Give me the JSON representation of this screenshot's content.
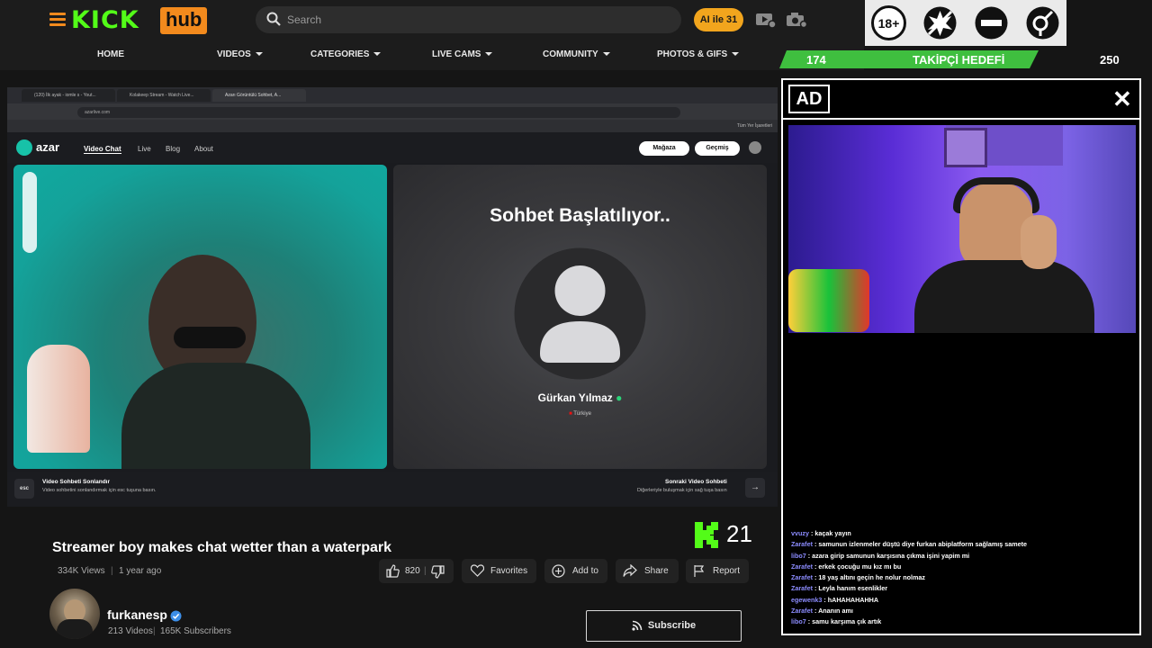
{
  "header": {
    "logo_kick": "KICK",
    "logo_hub": "hub",
    "search_placeholder": "Search",
    "promo_label": "AI ile 31",
    "nav": [
      "HOME",
      "VIDEOS",
      "CATEGORIES",
      "LIVE CAMS",
      "COMMUNITY",
      "PHOTOS & GIFS"
    ]
  },
  "overlay": {
    "goal_current": "174",
    "goal_label": "TAKİPÇİ HEDEFİ",
    "goal_target": "250",
    "goal_progress": 0.696,
    "ad_label": "AD",
    "badge_18": "18+",
    "kick_count": "21"
  },
  "browser": {
    "tabs": [
      "(120) İlk ayak - iomle s - Yout...",
      "Kolakeep Stream - Watch Live...",
      "Azarı Görüntülü Sohbet, A..."
    ],
    "address": "azarlive.com",
    "bookmark": "Tüm Yer İşaretleri"
  },
  "azar": {
    "logo": "azar",
    "nav": [
      "Video Chat",
      "Live",
      "Blog",
      "About"
    ],
    "store_btn": "Mağaza",
    "history_btn": "Geçmiş",
    "connecting_text": "Sohbet Başlatılıyor..",
    "peer_name": "Gürkan Yılmaz",
    "peer_country": "Türkiye",
    "esc_key": "esc",
    "end_title": "Video Sohbeti Sonlandır",
    "end_sub": "Video sohbetini sonlandırmak için esc tuşuna basın.",
    "next_title": "Sonraki Video Sohbeti",
    "next_sub": "Diğerleriyle buluşmak için sağ tuşa basın"
  },
  "video": {
    "title": "Streamer boy makes chat wetter than a waterpark",
    "views": "334K Views",
    "age": "1 year ago",
    "likes": "820",
    "favorites_label": "Favorites",
    "add_label": "Add to",
    "share_label": "Share",
    "report_label": "Report"
  },
  "channel": {
    "name": "furkanesp",
    "videos": "213 Videos",
    "subscribers": "165K Subscribers",
    "subscribe_label": "Subscribe"
  },
  "chat": [
    {
      "user": "vvuzy",
      "msg": "kaçak yayın"
    },
    {
      "user": "Zarafet",
      "msg": "samunun izlenmeler düştü diye furkan abiplatform sağlamış samete"
    },
    {
      "user": "libo7",
      "msg": "azara girip samunun karşısına çıkma işini yapim mi"
    },
    {
      "user": "Zarafet",
      "msg": "erkek çocuğu mu kız mı bu"
    },
    {
      "user": "Zarafet",
      "msg": "18 yaş altını geçin he nolur nolmaz"
    },
    {
      "user": "Zarafet",
      "msg": "Leyla hanım esenlikler"
    },
    {
      "user": "egewenk3",
      "msg": "hAHAHAHAHHA"
    },
    {
      "user": "Zarafet",
      "msg": "Ananın amı"
    },
    {
      "user": "libo7",
      "msg": "samu karşıma çık artık"
    }
  ],
  "colors": {
    "kick_green": "#53fc18",
    "hub_orange": "#f28a1d",
    "promo_yellow": "#f2a51d"
  }
}
